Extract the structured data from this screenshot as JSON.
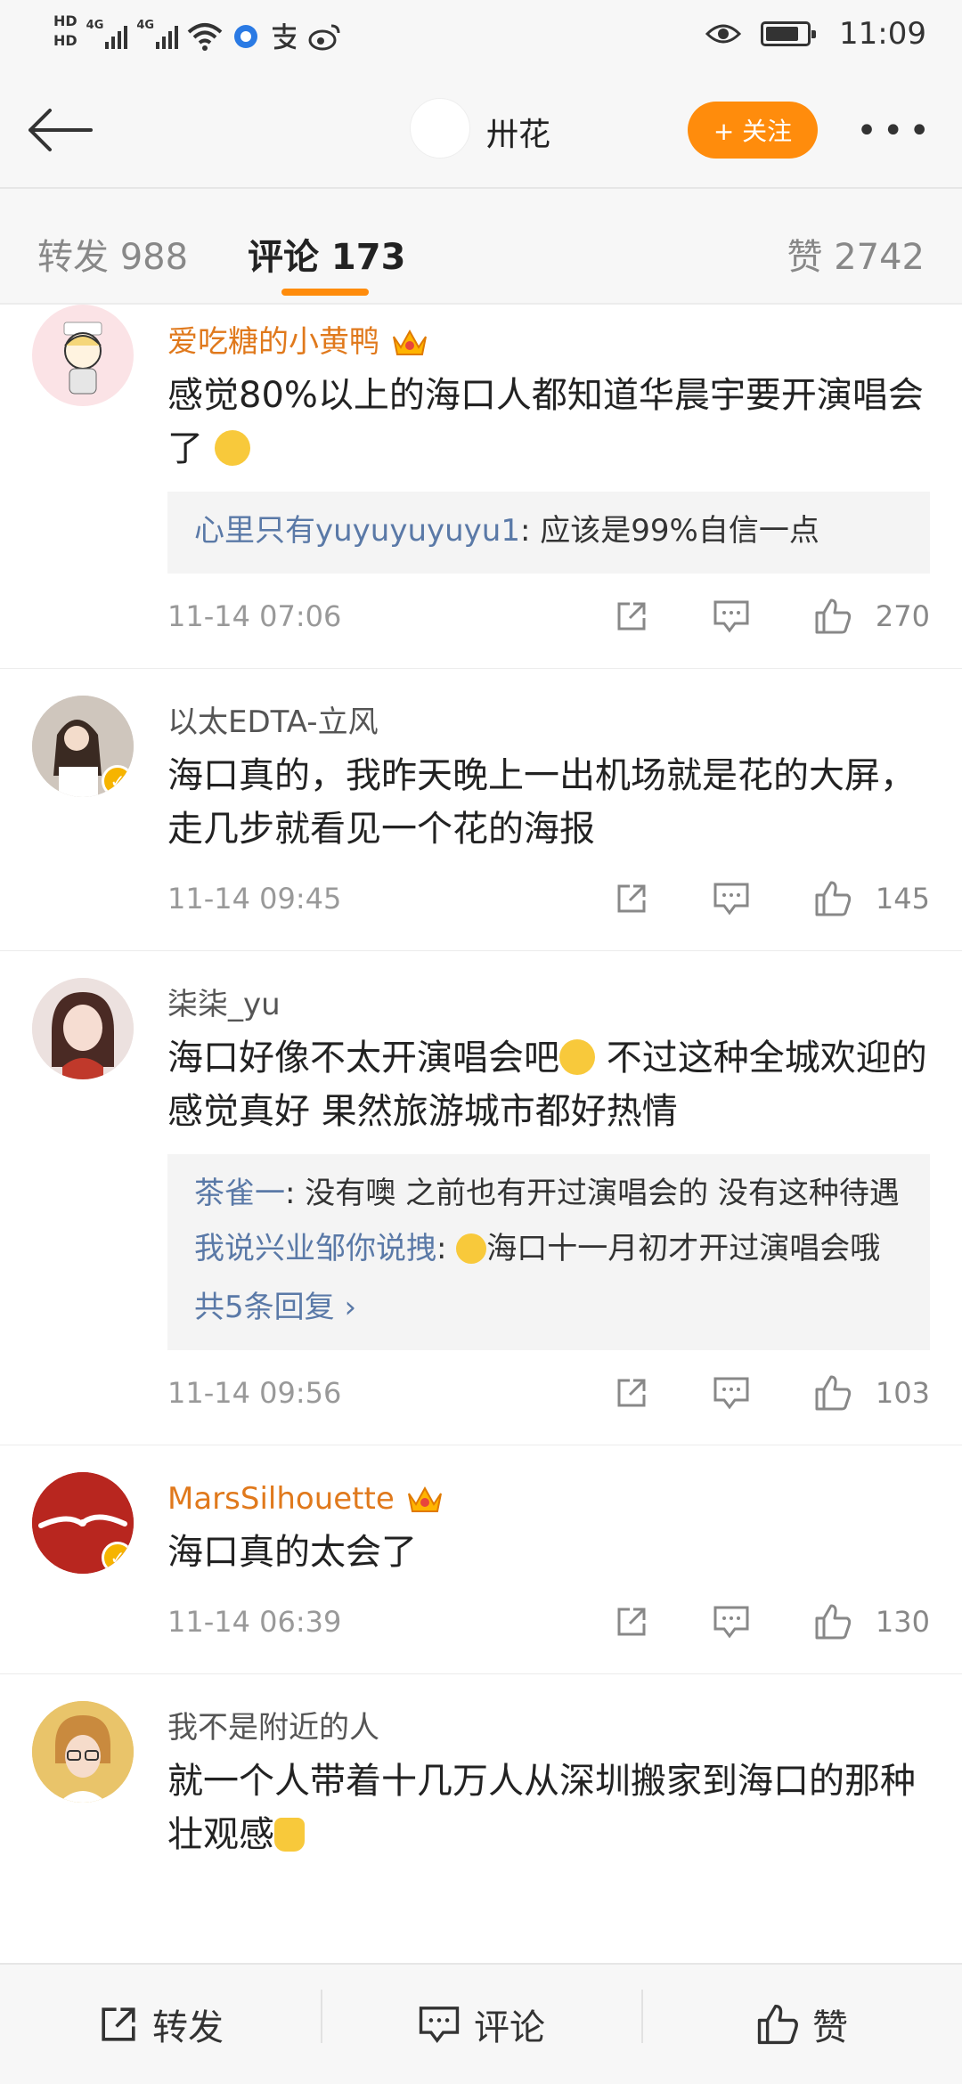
{
  "status_bar": {
    "hd1": "HD",
    "hd2": "HD",
    "net1": "4G",
    "net2": "4G",
    "time": "11:09"
  },
  "header": {
    "title": "卅花",
    "follow_label": "+ 关注",
    "more_label": "•••"
  },
  "tabs": [
    {
      "label": "转发 988"
    },
    {
      "label": "评论 173"
    },
    {
      "label": "赞 2742"
    }
  ],
  "comments": [
    {
      "name": "爱吃糖的小黄鸭",
      "text": "感觉80%以上的海口人都知道华晨宇要开演唱会了",
      "replies": [
        {
          "name": "心里只有yuyuyuyuyu1",
          "text": ": 应该是99%自信一点"
        }
      ],
      "time": "11-14 07:06",
      "likes": "270"
    },
    {
      "name": "以太EDTA-立风",
      "text": "海口真的，我昨天晚上一出机场就是花的大屏，走几步就看见一个花的海报",
      "time": "11-14 09:45",
      "likes": "145"
    },
    {
      "name": "柒柒_yu",
      "text": "海口好像不太开演唱会吧",
      "text2": " 不过这种全城欢迎的感觉真好 果然旅游城市都好热情",
      "replies": [
        {
          "name": "茶雀一",
          "text": ": 没有噢 之前也有开过演唱会的 没有这种待遇"
        },
        {
          "name": "我说兴业邹你说拽",
          "text": "海口十一月初才开过演唱会哦"
        }
      ],
      "more_replies": "共5条回复 ›",
      "time": "11-14 09:56",
      "likes": "103"
    },
    {
      "name": "MarsSilhouette",
      "text": "海口真的太会了",
      "time": "11-14 06:39",
      "likes": "130"
    },
    {
      "name": "我不是附近的人",
      "text": "就一个人带着十几万人从深圳搬家到海口的那种壮观感"
    }
  ],
  "bottom_bar": {
    "repost": "转发",
    "comment": "评论",
    "like": "赞"
  },
  "colors": {
    "accent": "#ff8c0c",
    "vip_name": "#e0791c",
    "reply_name": "#5a79a7"
  }
}
